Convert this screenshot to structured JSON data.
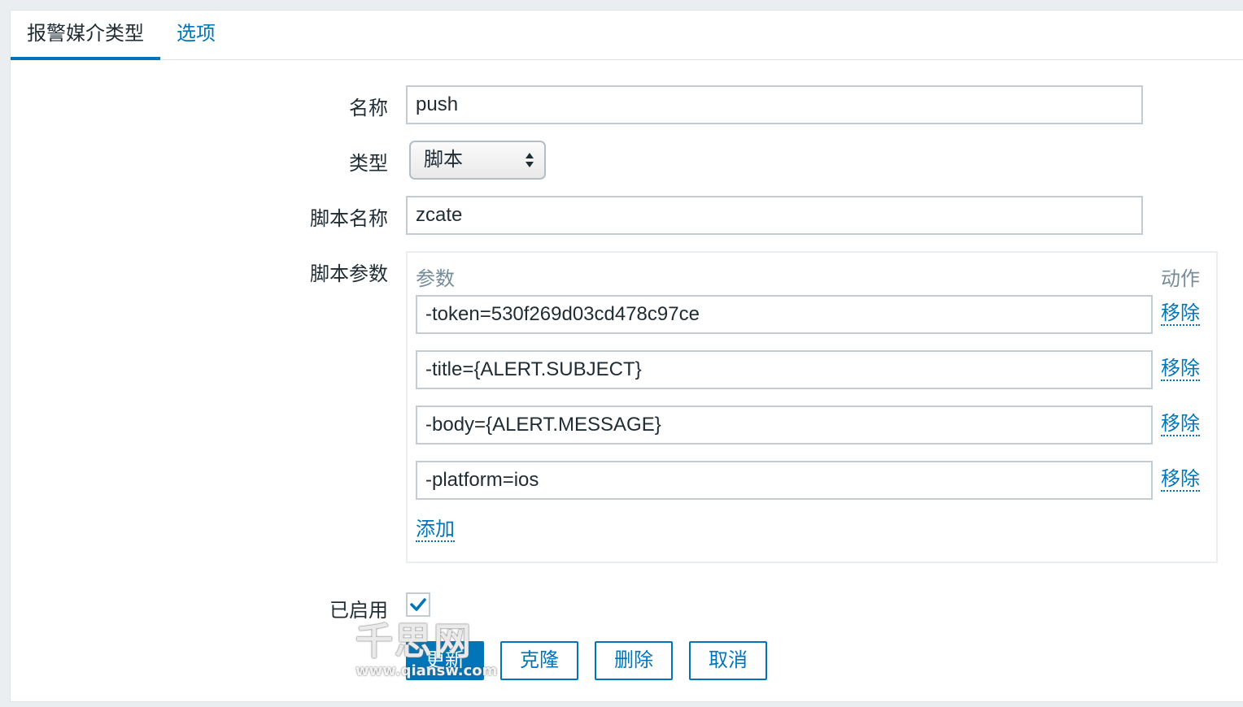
{
  "tabs": [
    {
      "label": "报警媒介类型",
      "active": true
    },
    {
      "label": "选项",
      "active": false
    }
  ],
  "form": {
    "name_label": "名称",
    "name_value": "push",
    "type_label": "类型",
    "type_value": "脚本",
    "script_name_label": "脚本名称",
    "script_name_value": "zcate",
    "script_params_label": "脚本参数",
    "params_header": "参数",
    "action_header": "动作",
    "params": [
      {
        "value": "-token=530f269d03cd478c97ce",
        "remove_label": "移除"
      },
      {
        "value": "-title={ALERT.SUBJECT}",
        "remove_label": "移除"
      },
      {
        "value": "-body={ALERT.MESSAGE}",
        "remove_label": "移除"
      },
      {
        "value": "-platform=ios",
        "remove_label": "移除"
      }
    ],
    "add_label": "添加",
    "enabled_label": "已启用",
    "enabled_checked": true
  },
  "buttons": {
    "update": "更新",
    "clone": "克隆",
    "delete": "删除",
    "cancel": "取消"
  },
  "watermark": {
    "big": "千思网",
    "small": "www.qiansw.com"
  },
  "colors": {
    "accent": "#0275b8",
    "border": "#c3ccd2",
    "muted": "#768d99"
  }
}
